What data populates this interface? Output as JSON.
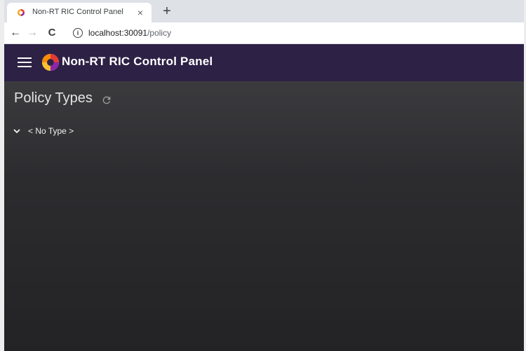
{
  "browser": {
    "tab": {
      "title": "Non-RT RIC Control Panel",
      "close_glyph": "×",
      "favicon": "ric-logo-icon"
    },
    "new_tab_glyph": "+",
    "toolbar": {
      "back_glyph": "←",
      "forward_glyph": "→",
      "reload_glyph": "C",
      "info_glyph": "i",
      "url_host": "localhost:30091",
      "url_path": "/policy"
    }
  },
  "app": {
    "title": "Non-RT RIC Control Panel",
    "header_color": "#2d2146",
    "menu_icon": "hamburger-menu-icon",
    "logo_icon": "ric-logo-icon"
  },
  "page": {
    "title": "Policy Types",
    "refresh_icon": "refresh-icon",
    "policy_types": [
      {
        "label": "< No Type >",
        "expanded": true
      }
    ]
  }
}
